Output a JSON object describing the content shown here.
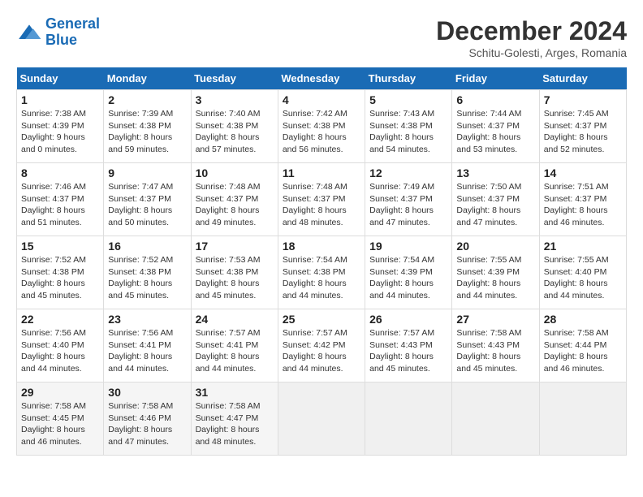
{
  "logo": {
    "text_general": "General",
    "text_blue": "Blue"
  },
  "title": "December 2024",
  "subtitle": "Schitu-Golesti, Arges, Romania",
  "days_of_week": [
    "Sunday",
    "Monday",
    "Tuesday",
    "Wednesday",
    "Thursday",
    "Friday",
    "Saturday"
  ],
  "weeks": [
    [
      {
        "day": "1",
        "sunrise": "7:38 AM",
        "sunset": "4:39 PM",
        "daylight": "9 hours and 0 minutes."
      },
      {
        "day": "2",
        "sunrise": "7:39 AM",
        "sunset": "4:38 PM",
        "daylight": "8 hours and 59 minutes."
      },
      {
        "day": "3",
        "sunrise": "7:40 AM",
        "sunset": "4:38 PM",
        "daylight": "8 hours and 57 minutes."
      },
      {
        "day": "4",
        "sunrise": "7:42 AM",
        "sunset": "4:38 PM",
        "daylight": "8 hours and 56 minutes."
      },
      {
        "day": "5",
        "sunrise": "7:43 AM",
        "sunset": "4:38 PM",
        "daylight": "8 hours and 54 minutes."
      },
      {
        "day": "6",
        "sunrise": "7:44 AM",
        "sunset": "4:37 PM",
        "daylight": "8 hours and 53 minutes."
      },
      {
        "day": "7",
        "sunrise": "7:45 AM",
        "sunset": "4:37 PM",
        "daylight": "8 hours and 52 minutes."
      }
    ],
    [
      {
        "day": "8",
        "sunrise": "7:46 AM",
        "sunset": "4:37 PM",
        "daylight": "8 hours and 51 minutes."
      },
      {
        "day": "9",
        "sunrise": "7:47 AM",
        "sunset": "4:37 PM",
        "daylight": "8 hours and 50 minutes."
      },
      {
        "day": "10",
        "sunrise": "7:48 AM",
        "sunset": "4:37 PM",
        "daylight": "8 hours and 49 minutes."
      },
      {
        "day": "11",
        "sunrise": "7:48 AM",
        "sunset": "4:37 PM",
        "daylight": "8 hours and 48 minutes."
      },
      {
        "day": "12",
        "sunrise": "7:49 AM",
        "sunset": "4:37 PM",
        "daylight": "8 hours and 47 minutes."
      },
      {
        "day": "13",
        "sunrise": "7:50 AM",
        "sunset": "4:37 PM",
        "daylight": "8 hours and 47 minutes."
      },
      {
        "day": "14",
        "sunrise": "7:51 AM",
        "sunset": "4:37 PM",
        "daylight": "8 hours and 46 minutes."
      }
    ],
    [
      {
        "day": "15",
        "sunrise": "7:52 AM",
        "sunset": "4:38 PM",
        "daylight": "8 hours and 45 minutes."
      },
      {
        "day": "16",
        "sunrise": "7:52 AM",
        "sunset": "4:38 PM",
        "daylight": "8 hours and 45 minutes."
      },
      {
        "day": "17",
        "sunrise": "7:53 AM",
        "sunset": "4:38 PM",
        "daylight": "8 hours and 45 minutes."
      },
      {
        "day": "18",
        "sunrise": "7:54 AM",
        "sunset": "4:38 PM",
        "daylight": "8 hours and 44 minutes."
      },
      {
        "day": "19",
        "sunrise": "7:54 AM",
        "sunset": "4:39 PM",
        "daylight": "8 hours and 44 minutes."
      },
      {
        "day": "20",
        "sunrise": "7:55 AM",
        "sunset": "4:39 PM",
        "daylight": "8 hours and 44 minutes."
      },
      {
        "day": "21",
        "sunrise": "7:55 AM",
        "sunset": "4:40 PM",
        "daylight": "8 hours and 44 minutes."
      }
    ],
    [
      {
        "day": "22",
        "sunrise": "7:56 AM",
        "sunset": "4:40 PM",
        "daylight": "8 hours and 44 minutes."
      },
      {
        "day": "23",
        "sunrise": "7:56 AM",
        "sunset": "4:41 PM",
        "daylight": "8 hours and 44 minutes."
      },
      {
        "day": "24",
        "sunrise": "7:57 AM",
        "sunset": "4:41 PM",
        "daylight": "8 hours and 44 minutes."
      },
      {
        "day": "25",
        "sunrise": "7:57 AM",
        "sunset": "4:42 PM",
        "daylight": "8 hours and 44 minutes."
      },
      {
        "day": "26",
        "sunrise": "7:57 AM",
        "sunset": "4:43 PM",
        "daylight": "8 hours and 45 minutes."
      },
      {
        "day": "27",
        "sunrise": "7:58 AM",
        "sunset": "4:43 PM",
        "daylight": "8 hours and 45 minutes."
      },
      {
        "day": "28",
        "sunrise": "7:58 AM",
        "sunset": "4:44 PM",
        "daylight": "8 hours and 46 minutes."
      }
    ],
    [
      {
        "day": "29",
        "sunrise": "7:58 AM",
        "sunset": "4:45 PM",
        "daylight": "8 hours and 46 minutes."
      },
      {
        "day": "30",
        "sunrise": "7:58 AM",
        "sunset": "4:46 PM",
        "daylight": "8 hours and 47 minutes."
      },
      {
        "day": "31",
        "sunrise": "7:58 AM",
        "sunset": "4:47 PM",
        "daylight": "8 hours and 48 minutes."
      },
      null,
      null,
      null,
      null
    ]
  ]
}
